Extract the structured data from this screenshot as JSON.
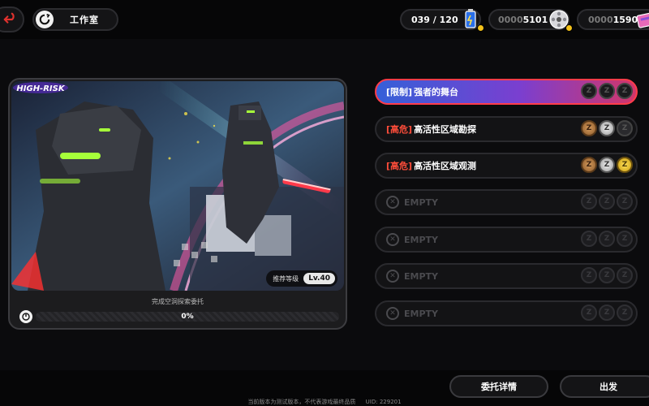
{
  "header": {
    "title": "工作室",
    "resources": {
      "battery": {
        "value": "039 / 120",
        "icon": "battery-icon"
      },
      "film": {
        "prefix": "0000",
        "value": "5101",
        "icon": "film-reel-icon"
      },
      "ticket": {
        "prefix": "0000",
        "value": "1590",
        "icon": "ticket-icon"
      }
    }
  },
  "mission_card": {
    "logo_text": "HIGH-RISK",
    "recommended_label": "推荐等级",
    "recommended_level": "Lv.40",
    "progress_title": "完成空洞探索委托",
    "progress_value": "0%",
    "progress_fraction": 0
  },
  "slots": [
    {
      "tag": "[限制]",
      "name": "强者的舞台",
      "active": true,
      "empty": false,
      "medals": [
        "dark",
        "dark",
        "dark"
      ]
    },
    {
      "tag": "[高危]",
      "name": "高活性区域勘探",
      "active": false,
      "empty": false,
      "medals": [
        "bronze",
        "silver",
        "dark"
      ]
    },
    {
      "tag": "[高危]",
      "name": "高活性区域观测",
      "active": false,
      "empty": false,
      "medals": [
        "bronze",
        "silver",
        "gold"
      ]
    },
    {
      "tag": "",
      "name": "EMPTY",
      "active": false,
      "empty": true,
      "medals": [
        "empty",
        "empty",
        "empty"
      ]
    },
    {
      "tag": "",
      "name": "EMPTY",
      "active": false,
      "empty": true,
      "medals": [
        "empty",
        "empty",
        "empty"
      ]
    },
    {
      "tag": "",
      "name": "EMPTY",
      "active": false,
      "empty": true,
      "medals": [
        "empty",
        "empty",
        "empty"
      ]
    },
    {
      "tag": "",
      "name": "EMPTY",
      "active": false,
      "empty": true,
      "medals": [
        "empty",
        "empty",
        "empty"
      ]
    }
  ],
  "medal_glyph": "Z",
  "buttons": {
    "detail": "委托详情",
    "depart": "出发"
  },
  "footer": {
    "note": "当前版本为测试版本，不代表游戏最终品质",
    "uid": "UID: 229201"
  },
  "colors": {
    "accent_yellow": "#f4c21a",
    "danger_red": "#ff4d3a",
    "active_gradient_start": "#3560d8",
    "active_gradient_end": "#d2366a"
  }
}
